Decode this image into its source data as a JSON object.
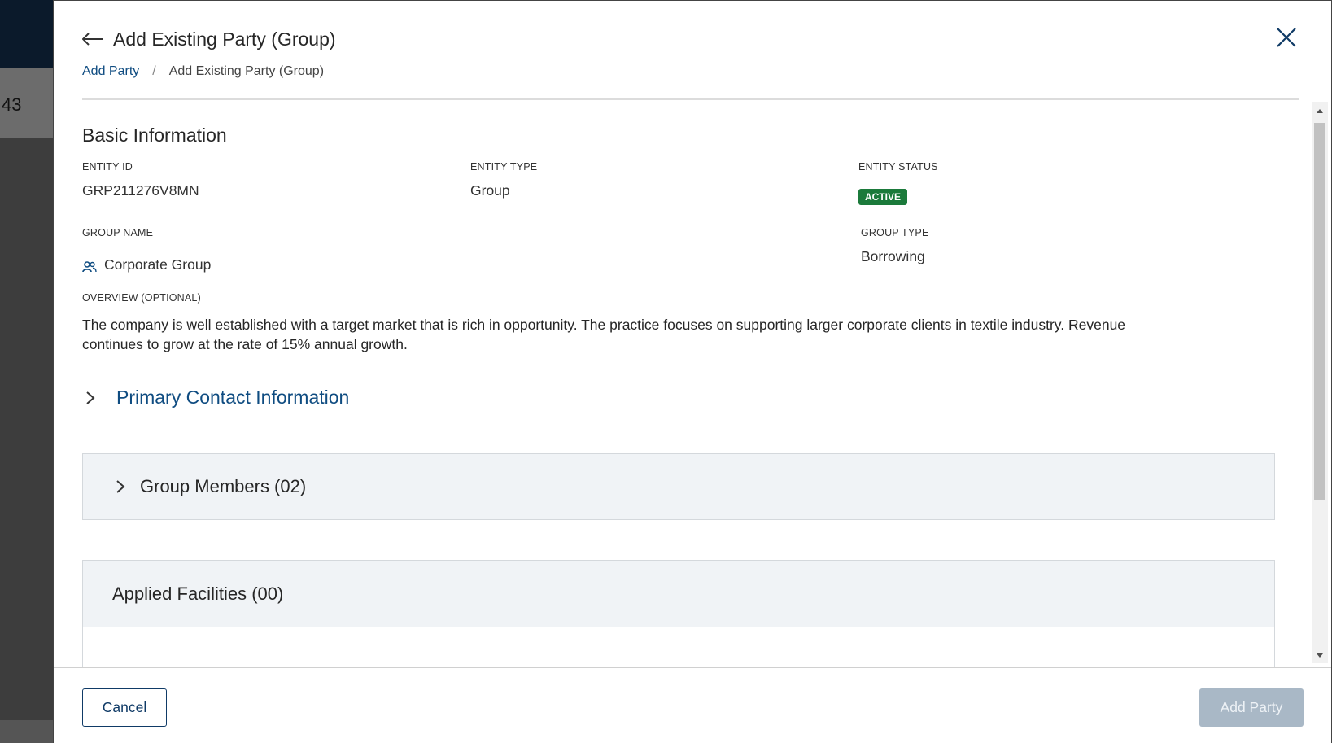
{
  "background": {
    "visible_number": "43"
  },
  "header": {
    "title": "Add Existing Party (Group)",
    "breadcrumb": {
      "link": "Add Party",
      "separator": "/",
      "current": "Add Existing Party (Group)"
    }
  },
  "basic_info": {
    "section_title": "Basic Information",
    "entity_id": {
      "label": "ENTITY ID",
      "value": "GRP211276V8MN"
    },
    "entity_type": {
      "label": "ENTITY TYPE",
      "value": "Group"
    },
    "entity_status": {
      "label": "ENTITY STATUS",
      "value": "ACTIVE",
      "color": "#1b7a3b"
    },
    "group_name": {
      "label": "GROUP NAME",
      "value": "Corporate Group"
    },
    "group_type": {
      "label": "GROUP TYPE",
      "value": "Borrowing"
    },
    "overview": {
      "label": "OVERVIEW (OPTIONAL)",
      "value": "The company is well established with a target market that is rich in opportunity. The practice focuses on supporting larger corporate clients in textile industry. Revenue continues to grow at the rate of 15% annual growth."
    }
  },
  "sections": {
    "primary_contact": "Primary Contact Information",
    "group_members": "Group Members (02)",
    "applied_facilities": "Applied Facilities (00)"
  },
  "footer": {
    "cancel_label": "Cancel",
    "add_label": "Add Party"
  },
  "colors": {
    "link": "#0f4c81",
    "primary_disabled": "#a9b8c6",
    "panel_bg": "#f0f3f6"
  }
}
